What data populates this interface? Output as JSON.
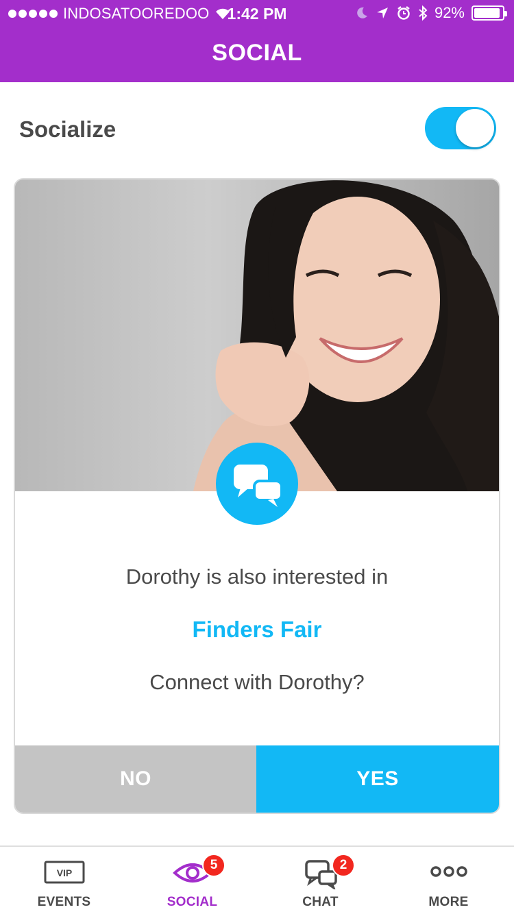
{
  "status_bar": {
    "carrier": "INDOSATOOREDOO",
    "time": "1:42 PM",
    "battery": "92%",
    "battery_level": 0.92
  },
  "header": {
    "title": "SOCIAL"
  },
  "socialize": {
    "label": "Socialize",
    "enabled": true
  },
  "card": {
    "interest_text": "Dorothy is also interested in",
    "event_name": "Finders Fair",
    "question": "Connect with Dorothy?",
    "no_label": "NO",
    "yes_label": "YES"
  },
  "tabs": [
    {
      "label": "EVENTS",
      "icon": "vip-icon",
      "icon_text": "VIP"
    },
    {
      "label": "SOCIAL",
      "icon": "eye-icon",
      "badge": "5",
      "active": true
    },
    {
      "label": "CHAT",
      "icon": "chat-bubbles-icon",
      "badge": "2"
    },
    {
      "label": "MORE",
      "icon": "more-dots-icon"
    }
  ],
  "colors": {
    "brand_purple": "#a32ecb",
    "accent_blue": "#12b8f5",
    "badge_red": "#f2271f",
    "no_gray": "#c4c4c4"
  }
}
